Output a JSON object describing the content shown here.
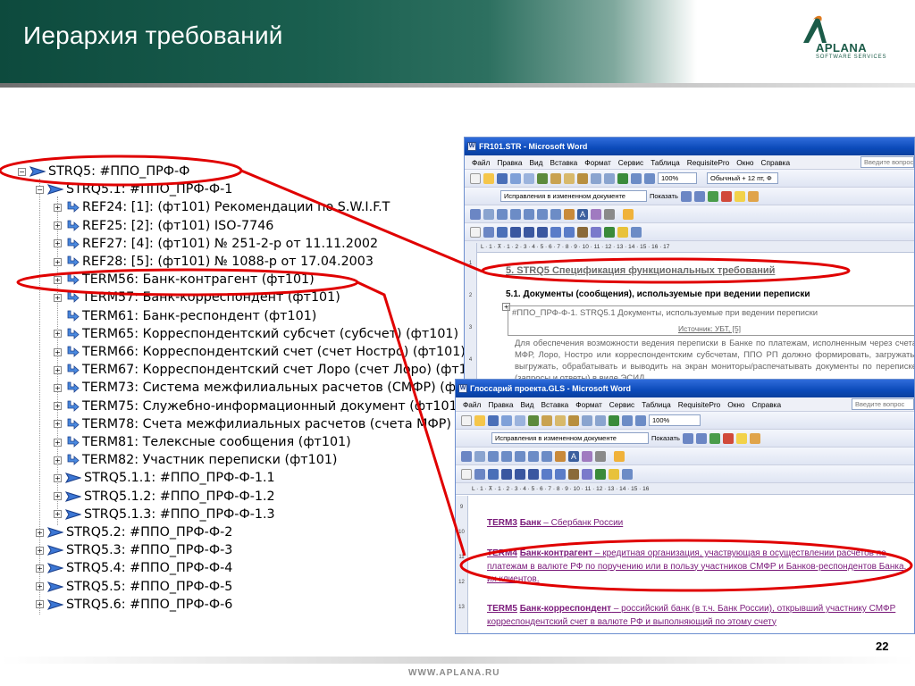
{
  "slide": {
    "title": "Иерархия требований",
    "page_number": "22",
    "footer_url": "WWW.APLANA.RU"
  },
  "logo": {
    "word": "APLANA",
    "subtitle": "SOFTWARE SERVICES"
  },
  "colors": {
    "header_green": "#0d4a3d",
    "highlight_red": "#e00000",
    "word_titlebar_blue": "#0b4ab9",
    "term_purple": "#7a1a7a"
  },
  "tree": {
    "items": [
      {
        "text": "STRQ5: #ППО_ПРФ-Ф",
        "icon": "flag-icon",
        "level": 0,
        "expander": "minus"
      },
      {
        "text": "STRQ5.1: #ППО_ПРФ-Ф-1",
        "icon": "flag-icon",
        "level": 1,
        "expander": "minus"
      },
      {
        "text": "REF24: [1]: (фт101) Рекомендации по S.W.I.F.T",
        "icon": "link-arrow-icon",
        "level": 2,
        "expander": "plus"
      },
      {
        "text": "REF25: [2]: (фт101)  ISO-7746",
        "icon": "link-arrow-icon",
        "level": 2,
        "expander": "plus"
      },
      {
        "text": "REF27: [4]: (фт101) № 251-2-р от 11.11.2002",
        "icon": "link-arrow-icon",
        "level": 2,
        "expander": "plus"
      },
      {
        "text": "REF28: [5]: (фт101) № 1088-р от 17.04.2003",
        "icon": "link-arrow-icon",
        "level": 2,
        "expander": "plus"
      },
      {
        "text": "TERM56: Банк-контрагент (фт101)",
        "icon": "link-arrow-icon",
        "level": 2,
        "expander": "plus"
      },
      {
        "text": "TERM57: Банк-корреспондент (фт101)",
        "icon": "link-arrow-icon",
        "level": 2,
        "expander": "plus"
      },
      {
        "text": "TERM61: Банк-респондент (фт101)",
        "icon": "link-arrow-icon",
        "level": 2,
        "expander": "none"
      },
      {
        "text": "TERM65: Корреспондентский субсчет (субсчет) (фт101)",
        "icon": "link-arrow-icon",
        "level": 2,
        "expander": "plus"
      },
      {
        "text": "TERM66: Корреспондентский счет (счет Ностро) (фт101)",
        "icon": "link-arrow-icon",
        "level": 2,
        "expander": "plus"
      },
      {
        "text": "TERM67: Корреспондентский счет Лоро (счет Лоро) (фт101)",
        "icon": "link-arrow-icon",
        "level": 2,
        "expander": "plus"
      },
      {
        "text": "TERM73: Система межфилиальных расчетов (СМФР) (фт101)",
        "icon": "link-arrow-icon",
        "level": 2,
        "expander": "plus"
      },
      {
        "text": "TERM75: Служебно-информационный документ (фт101)",
        "icon": "link-arrow-icon",
        "level": 2,
        "expander": "plus"
      },
      {
        "text": "TERM78: Счета межфилиальных расчетов (счета МФР) (фт101)",
        "icon": "link-arrow-icon",
        "level": 2,
        "expander": "plus"
      },
      {
        "text": "TERM81: Телексные сообщения (фт101)",
        "icon": "link-arrow-icon",
        "level": 2,
        "expander": "plus"
      },
      {
        "text": "TERM82: Участник переписки (фт101)",
        "icon": "link-arrow-icon",
        "level": 2,
        "expander": "plus"
      },
      {
        "text": "STRQ5.1.1: #ППО_ПРФ-Ф-1.1",
        "icon": "flag-icon",
        "level": 2,
        "expander": "plus"
      },
      {
        "text": "STRQ5.1.2: #ППО_ПРФ-Ф-1.2",
        "icon": "flag-icon",
        "level": 2,
        "expander": "plus"
      },
      {
        "text": "STRQ5.1.3: #ППО_ПРФ-Ф-1.3",
        "icon": "flag-icon",
        "level": 2,
        "expander": "plus"
      },
      {
        "text": "STRQ5.2: #ППО_ПРФ-Ф-2",
        "icon": "flag-icon",
        "level": 1,
        "expander": "plus"
      },
      {
        "text": "STRQ5.3: #ППО_ПРФ-Ф-3",
        "icon": "flag-icon",
        "level": 1,
        "expander": "plus"
      },
      {
        "text": "STRQ5.4: #ППО_ПРФ-Ф-4",
        "icon": "flag-icon",
        "level": 1,
        "expander": "plus"
      },
      {
        "text": "STRQ5.5: #ППО_ПРФ-Ф-5",
        "icon": "flag-icon",
        "level": 1,
        "expander": "plus"
      },
      {
        "text": "STRQ5.6: #ППО_ПРФ-Ф-6",
        "icon": "flag-icon",
        "level": 1,
        "expander": "plus"
      }
    ]
  },
  "word1": {
    "title": "FR101.STR - Microsoft Word",
    "menu": [
      "Файл",
      "Правка",
      "Вид",
      "Вставка",
      "Формат",
      "Сервис",
      "Таблица",
      "RequisitePro",
      "Окно",
      "Справка"
    ],
    "search_placeholder": "Введите вопрос",
    "zoom": "100%",
    "style": "Обычный + 12 пт, Ф",
    "tracking": "Исправления в измененном документе",
    "show_label": "Показать",
    "ruler": "L · 1 · ⊼ · 1 · 2 · 3 · 4 · 5 · 6 · 7 · 8 · 9 · 10 · 11 · 12 · 13 · 14 · 15 · 16 · 17",
    "heading": "5.  STRQ5 Спецификация функциональных требований",
    "section": "5.1.     Документы (сообщения), используемые при ведении переписки",
    "table_line1": "#ППО_ПРФ-Ф-1. STRQ5.1 Документы, используемые при ведении переписки",
    "table_num": "1",
    "table_line2": "Источник: УБТ, [5]",
    "body": "Для обеспечения возможности ведения переписки в Банке по платежам, исполненным через счета МФР, Лоро, Ностро или корреспондентским субсчетам, ППО РП должно формировать, загружать/выгружать, обрабатывать и выводить на экран мониторы/распечатывать документы по переписке (запросы и ответы) в виде ЭСИД"
  },
  "word2": {
    "title": "Глоссарий проекта.GLS - Microsoft Word",
    "menu": [
      "Файл",
      "Правка",
      "Вид",
      "Вставка",
      "Формат",
      "Сервис",
      "Таблица",
      "RequisitePro",
      "Окно",
      "Справка"
    ],
    "search_placeholder": "Введите вопрос",
    "zoom": "100%",
    "tracking": "Исправления в измененном документе",
    "show_label": "Показать",
    "ruler": "L · 1 · ⊼ · 1 · 2 · 3 · 4 · 5 · 6 · 7 · 8 · 9 · 10 · 11 · 12 · 13 · 14 · 15 · 16",
    "terms": [
      {
        "id": "TERM3",
        "name": "Банк",
        "def": " – Сбербанк России"
      },
      {
        "id": "TERM4",
        "name": "Банк-контрагент",
        "def": " – кредитная организация, участвующая в осуществлении расчетов по платежам в валюте РФ по поручению или в пользу участников СМФР и Банков-респондентов Банка, их клиентов."
      },
      {
        "id": "TERM5",
        "name": "Банк-корреспондент",
        "def": " – российский банк (в т.ч. Банк России), открывший участнику СМФР корреспондентский счет в валюте РФ и выполняющий по этому счету"
      }
    ]
  }
}
